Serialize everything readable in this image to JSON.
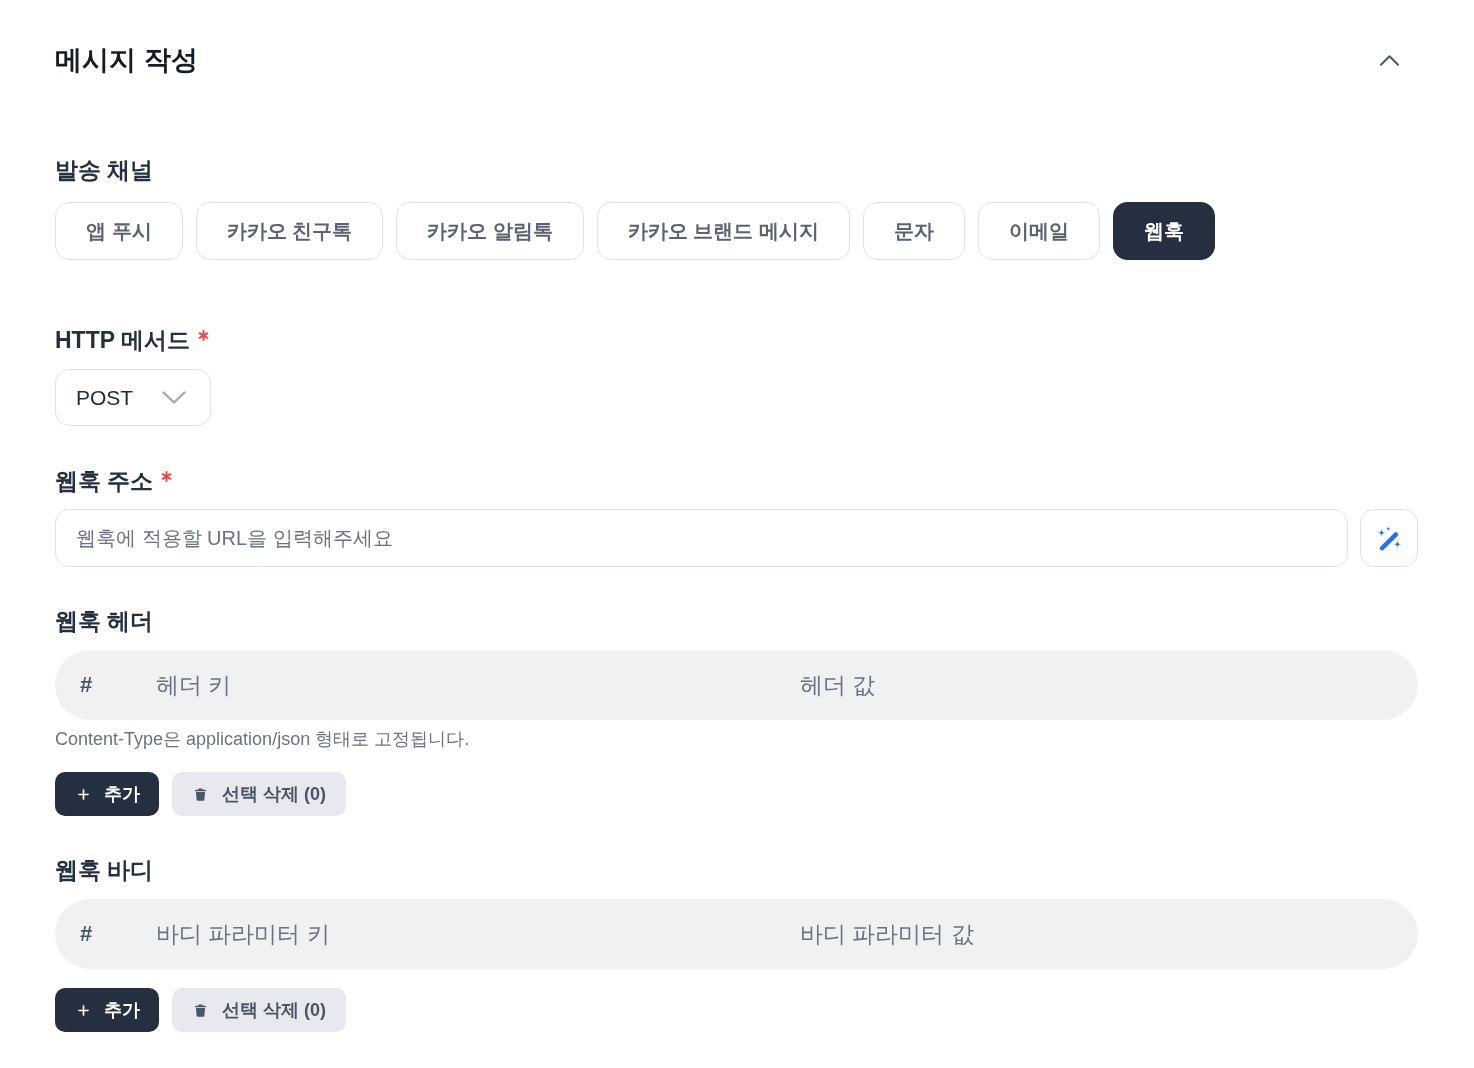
{
  "section": {
    "title": "메시지 작성",
    "expanded": true
  },
  "channel_field": {
    "label": "발송 채널",
    "options": [
      {
        "label": "앱 푸시",
        "selected": false
      },
      {
        "label": "카카오 친구톡",
        "selected": false
      },
      {
        "label": "카카오 알림톡",
        "selected": false
      },
      {
        "label": "카카오 브랜드 메시지",
        "selected": false
      },
      {
        "label": "문자",
        "selected": false
      },
      {
        "label": "이메일",
        "selected": false
      },
      {
        "label": "웹훅",
        "selected": true
      }
    ]
  },
  "method_field": {
    "label": "HTTP 메서드",
    "required": true,
    "value": "POST"
  },
  "url_field": {
    "label": "웹훅 주소",
    "required": true,
    "placeholder": "웹훅에 적용할 URL을 입력해주세요"
  },
  "header_table": {
    "label": "웹훅 헤더",
    "columns": [
      "#",
      "헤더 키",
      "헤더 값"
    ],
    "note": "Content-Type은 application/json 형태로 고정됩니다.",
    "buttons": [
      {
        "kind": "add",
        "label": "추가"
      },
      {
        "kind": "delete",
        "label": "선택 삭제 (0)"
      }
    ]
  },
  "body_table": {
    "label": "웹훅 바디",
    "columns": [
      "#",
      "바디 파라미터 키",
      "바디 파라미터 값"
    ],
    "buttons": [
      {
        "kind": "add",
        "label": "추가"
      },
      {
        "kind": "delete",
        "label": "선택 삭제 (0)"
      }
    ]
  }
}
